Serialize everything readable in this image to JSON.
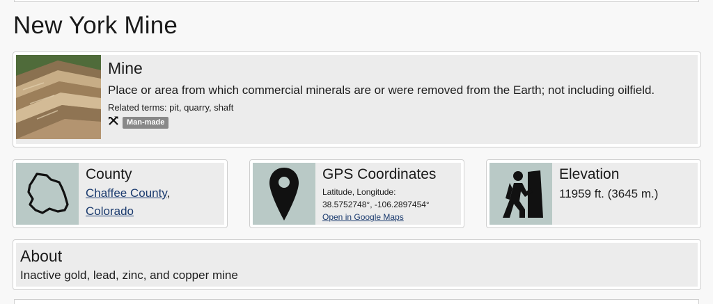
{
  "page": {
    "title": "New York Mine"
  },
  "feature": {
    "type_title": "Mine",
    "description": "Place or area from which commercial minerals are or were removed from the Earth; not including oilfield.",
    "related_terms": "Related terms: pit, quarry, shaft",
    "badge": "Man-made",
    "icons": {
      "category": "tools-icon",
      "photo": "mine-photo"
    }
  },
  "county": {
    "title": "County",
    "county_link": "Chaffee County",
    "separator": ",",
    "state_link": "Colorado",
    "icon": "county-outline-icon"
  },
  "gps": {
    "title": "GPS Coordinates",
    "label": "Latitude, Longitude:",
    "coords": "38.5752748°, -106.2897454°",
    "map_link": "Open in Google Maps",
    "icon": "map-pin-icon"
  },
  "elevation": {
    "title": "Elevation",
    "value": "11959 ft. (3645 m.)",
    "icon": "hiker-climb-icon"
  },
  "about": {
    "title": "About",
    "text": "Inactive gold, lead, zinc, and copper mine"
  }
}
